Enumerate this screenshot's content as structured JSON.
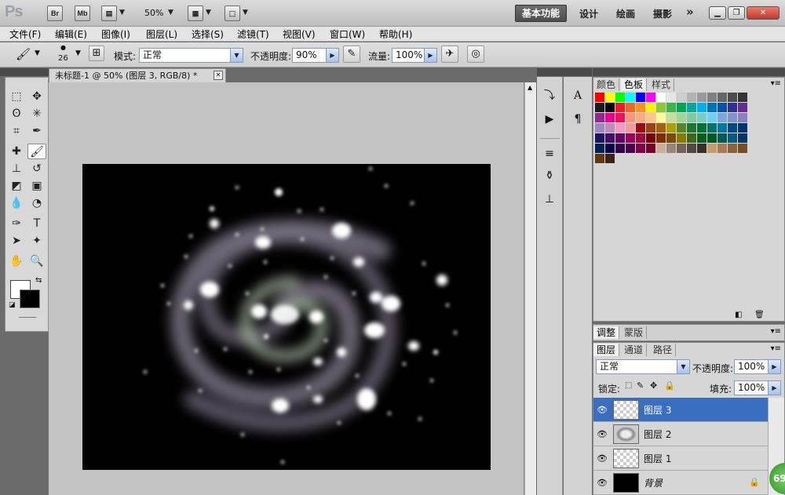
{
  "app": {
    "logo": "Ps",
    "bridge_label": "Br",
    "minibridge_label": "Mb",
    "zoom": "50%"
  },
  "workspaces": {
    "essentials": "基本功能",
    "design": "设计",
    "painting": "绘画",
    "photography": "摄影",
    "more": "»"
  },
  "menu": [
    "文件(F)",
    "编辑(E)",
    "图像(I)",
    "图层(L)",
    "选择(S)",
    "滤镜(T)",
    "视图(V)",
    "窗口(W)",
    "帮助(H)"
  ],
  "options": {
    "brush_size": "26",
    "mode_label": "模式:",
    "mode_value": "正常",
    "opacity_label": "不透明度:",
    "opacity_value": "90%",
    "flow_label": "流量:",
    "flow_value": "100%"
  },
  "document": {
    "tab_title": "未标题-1 @ 50% (图层 3, RGB/8) *"
  },
  "swatches_panel": {
    "tabs": [
      "颜色",
      "色板",
      "样式"
    ],
    "colors": [
      "#ff0000",
      "#ffff00",
      "#00ff00",
      "#00ffff",
      "#0000ff",
      "#ff00ff",
      "#ffffff",
      "#e6e6e6",
      "#cccccc",
      "#b3b3b3",
      "#999999",
      "#808080",
      "#666666",
      "#4d4d4d",
      "#333333",
      "#1a1a1a",
      "#000000",
      "#ed1c24",
      "#f26522",
      "#f7941d",
      "#fff200",
      "#8dc63f",
      "#39b54a",
      "#00a651",
      "#00a99d",
      "#00aeef",
      "#0072bc",
      "#0054a6",
      "#2e3192",
      "#662d91",
      "#92278f",
      "#ec008c",
      "#ed145b",
      "#f69679",
      "#f9ad81",
      "#fdc689",
      "#fff799",
      "#c4df9b",
      "#a3d39c",
      "#82ca9c",
      "#7accc8",
      "#6dcff6",
      "#7da7d9",
      "#8393ca",
      "#8781bd",
      "#a187be",
      "#bd8cbf",
      "#f49ac2",
      "#f5989d",
      "#9e0b0f",
      "#a0410d",
      "#a36209",
      "#aba000",
      "#598527",
      "#197b30",
      "#007236",
      "#00746b",
      "#0076a3",
      "#004a80",
      "#003471",
      "#1b1464",
      "#440e62",
      "#630460",
      "#9e005d",
      "#9e0039",
      "#790000",
      "#7b2e00",
      "#7d4900",
      "#827b00",
      "#406618",
      "#005e20",
      "#005826",
      "#005952",
      "#005b7f",
      "#003663",
      "#002157",
      "#0d004c",
      "#32004b",
      "#4b0049",
      "#7b0046",
      "#7a0026",
      "#c7b299",
      "#998675",
      "#736357",
      "#534741",
      "#37302a",
      "#c69c6d",
      "#a67c52",
      "#8c6239",
      "#754c24",
      "#603913",
      "#3c2415"
    ]
  },
  "adjust_panel": {
    "tabs": [
      "调整",
      "蒙版"
    ]
  },
  "layers_panel": {
    "tabs": [
      "图层",
      "通道",
      "路径"
    ],
    "blend_mode": "正常",
    "opacity_label": "不透明度:",
    "opacity_value": "100%",
    "lock_label": "锁定:",
    "fill_label": "填充:",
    "fill_value": "100%",
    "layers": [
      {
        "name": "图层 3",
        "selected": true
      },
      {
        "name": "图层 2",
        "selected": false
      },
      {
        "name": "图层 1",
        "selected": false
      },
      {
        "name": "背景",
        "selected": false
      }
    ]
  },
  "badge": {
    "text": "69"
  },
  "icons": {
    "brush": "brush-icon",
    "eye": "eye-icon",
    "lock": "lock-icon"
  }
}
